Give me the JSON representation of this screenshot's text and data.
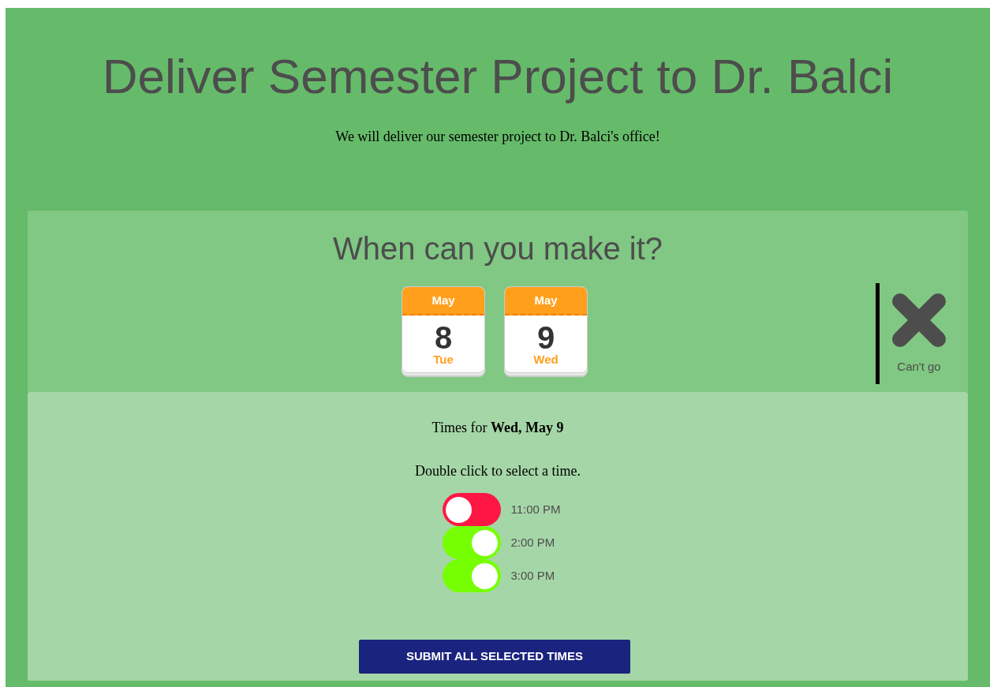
{
  "title": "Deliver Semester Project to Dr. Balci",
  "description": "We will deliver our semester project to Dr. Balci's office!",
  "question": "When can you make it?",
  "dates": [
    {
      "month": "May",
      "day": "8",
      "weekday": "Tue"
    },
    {
      "month": "May",
      "day": "9",
      "weekday": "Wed"
    }
  ],
  "cant_go": {
    "label": "Can't go"
  },
  "times_heading": "Times for **Wed, May 9**",
  "instruction": "Double click to select a time.",
  "times": [
    {
      "label": "11:00 PM",
      "on": false
    },
    {
      "label": "2:00 PM",
      "on": true
    },
    {
      "label": "3:00 PM",
      "on": true
    }
  ],
  "submit_button": "SUBMIT ALL SELECTED TIMES"
}
